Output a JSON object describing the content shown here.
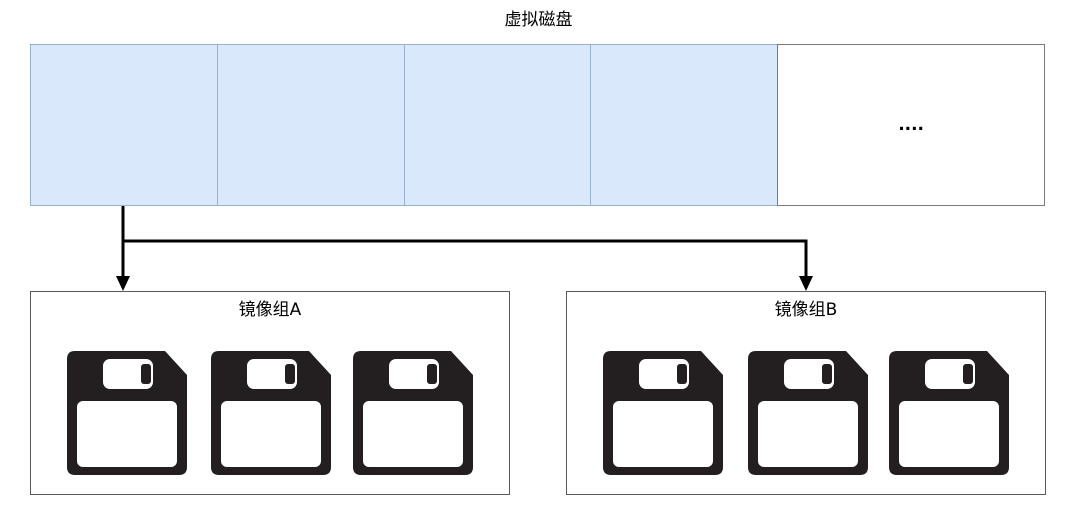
{
  "diagram": {
    "title": "虚拟磁盘",
    "disk_segments": [
      "",
      "",
      "",
      "",
      "...."
    ],
    "groups": [
      {
        "label": "镜像组A",
        "disk_count": 3
      },
      {
        "label": "镜像组B",
        "disk_count": 3
      }
    ],
    "colors": {
      "segment_fill": "#dae8fc",
      "segment_border": "#9ab0cf",
      "icon_fill": "#231f20"
    }
  }
}
